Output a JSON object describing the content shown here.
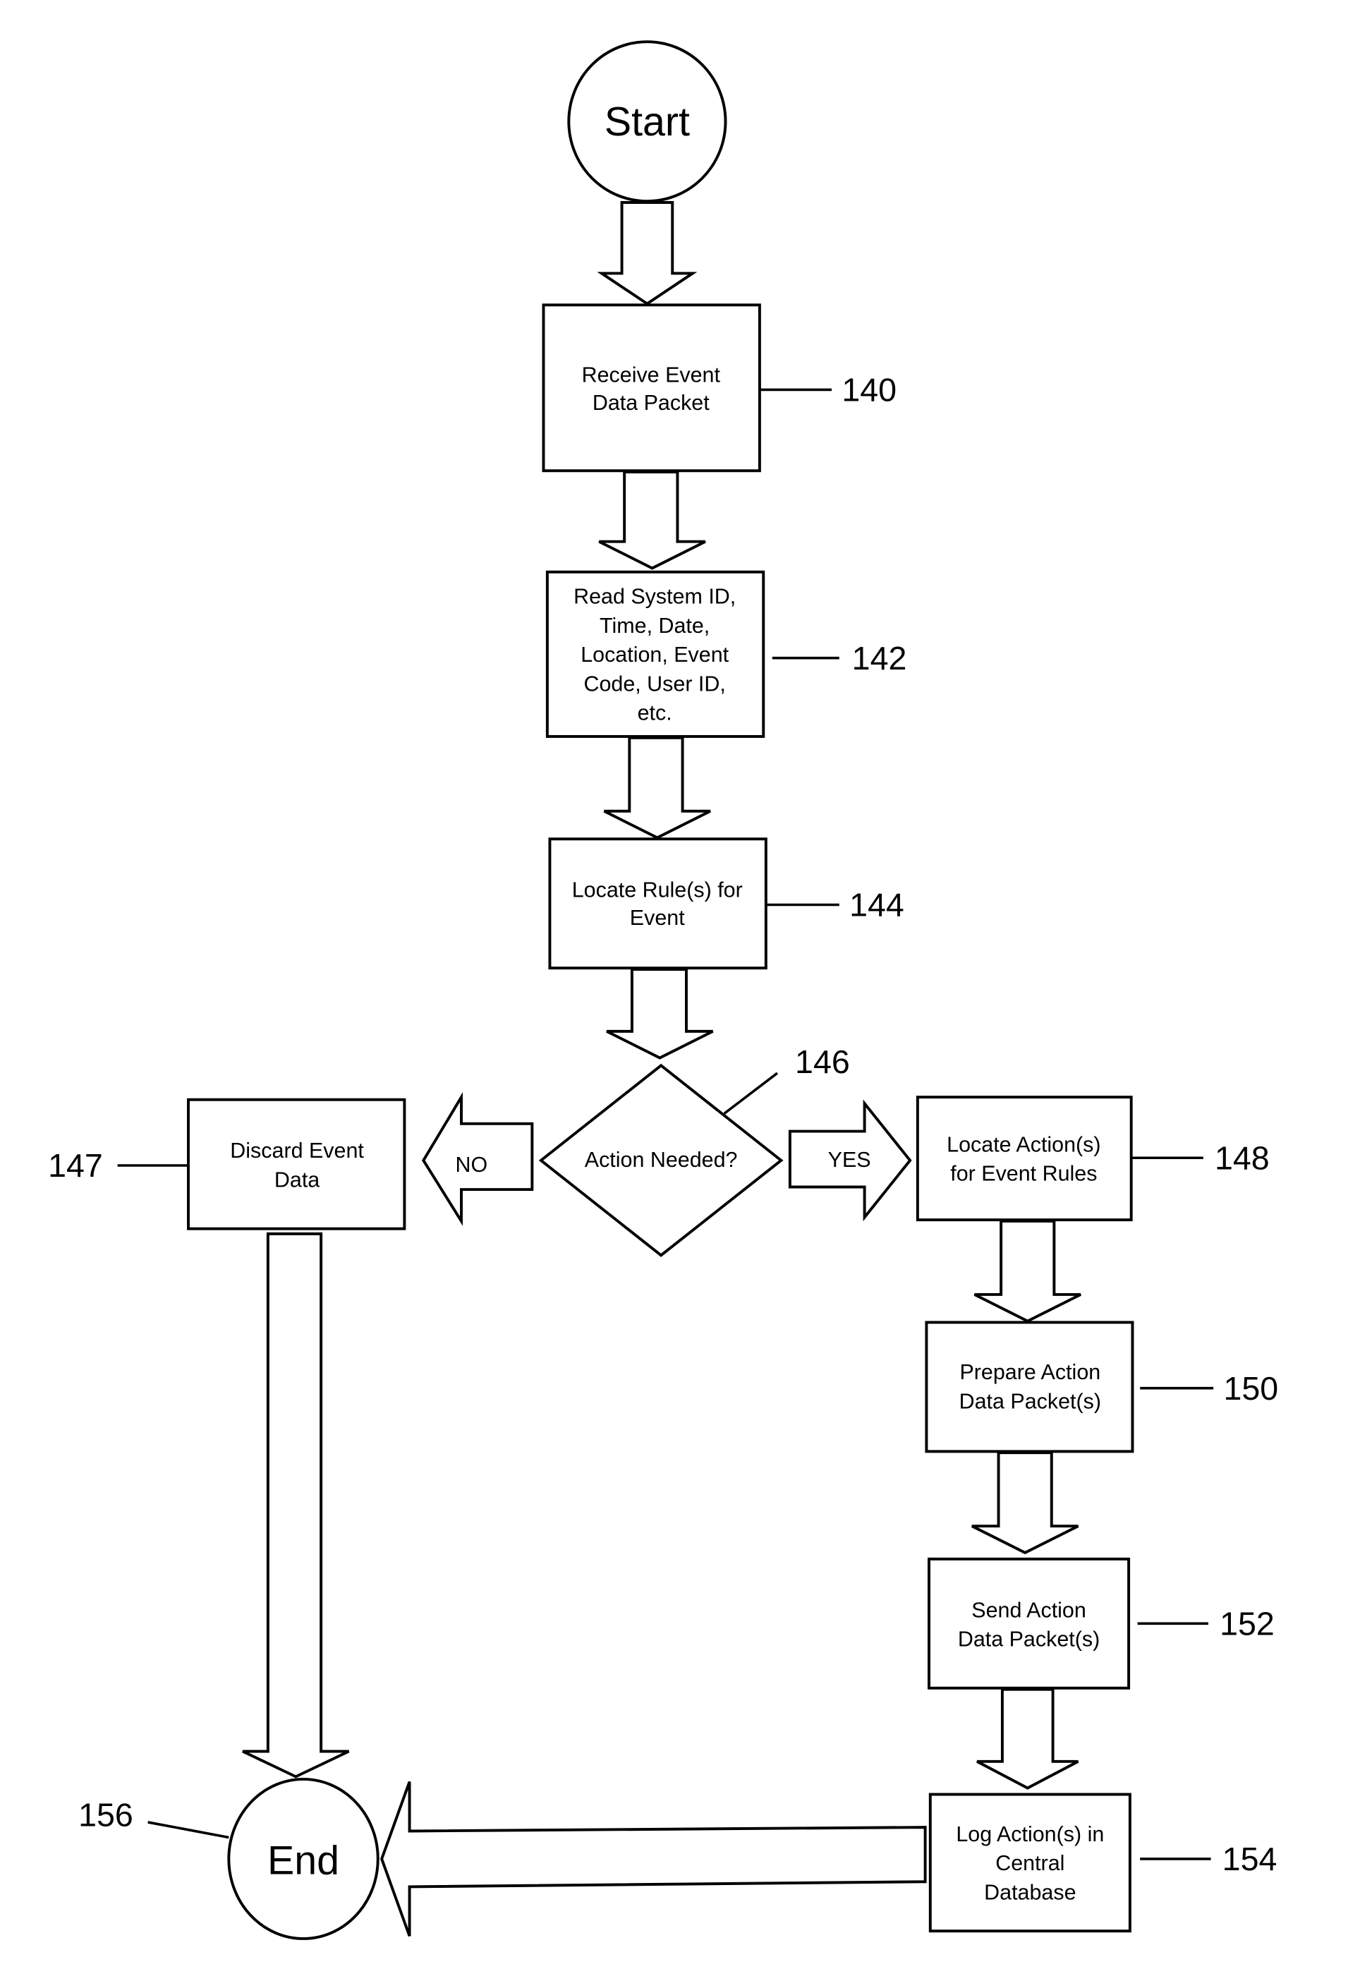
{
  "diagram": {
    "type": "flowchart",
    "terminals": {
      "start": {
        "label": "Start"
      },
      "end": {
        "label": "End",
        "ref": "156"
      }
    },
    "steps": [
      {
        "id": "140",
        "ref": "140",
        "lines": [
          "Receive Event",
          "Data Packet"
        ]
      },
      {
        "id": "142",
        "ref": "142",
        "lines": [
          "Read System ID,",
          "Time, Date,",
          "Location, Event",
          "Code, User ID,",
          "etc."
        ]
      },
      {
        "id": "144",
        "ref": "144",
        "lines": [
          "Locate Rule(s) for",
          "Event"
        ]
      },
      {
        "id": "147",
        "ref": "147",
        "lines": [
          "Discard Event",
          "Data"
        ]
      },
      {
        "id": "148",
        "ref": "148",
        "lines": [
          "Locate Action(s)",
          "for Event Rules"
        ]
      },
      {
        "id": "150",
        "ref": "150",
        "lines": [
          "Prepare Action",
          "Data Packet(s)"
        ]
      },
      {
        "id": "152",
        "ref": "152",
        "lines": [
          "Send Action",
          "Data Packet(s)"
        ]
      },
      {
        "id": "154",
        "ref": "154",
        "lines": [
          "Log Action(s) in",
          "Central",
          "Database"
        ]
      }
    ],
    "decision": {
      "ref": "146",
      "label": "Action Needed?",
      "no_label": "NO",
      "yes_label": "YES"
    },
    "edges": [
      {
        "from": "start",
        "to": "140"
      },
      {
        "from": "140",
        "to": "142"
      },
      {
        "from": "142",
        "to": "144"
      },
      {
        "from": "144",
        "to": "146"
      },
      {
        "from": "146",
        "to": "147",
        "label": "NO"
      },
      {
        "from": "146",
        "to": "148",
        "label": "YES"
      },
      {
        "from": "147",
        "to": "end"
      },
      {
        "from": "148",
        "to": "150"
      },
      {
        "from": "150",
        "to": "152"
      },
      {
        "from": "152",
        "to": "154"
      },
      {
        "from": "154",
        "to": "end"
      }
    ]
  }
}
